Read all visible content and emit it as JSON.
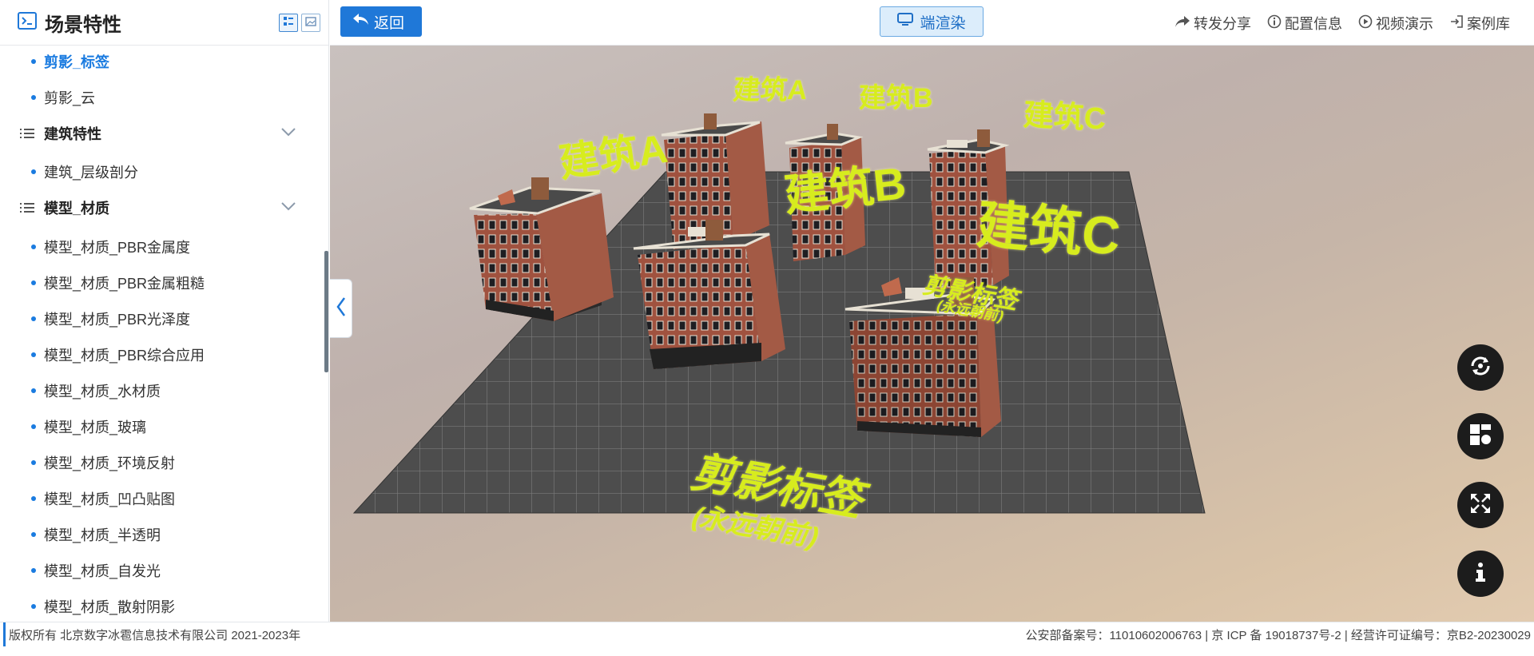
{
  "sidebar": {
    "title": "场景特性",
    "items": [
      {
        "type": "item",
        "label": "剪影_标签",
        "active": true
      },
      {
        "type": "item",
        "label": "剪影_云"
      },
      {
        "type": "group",
        "label": "建筑特性"
      },
      {
        "type": "item",
        "label": "建筑_层级剖分"
      },
      {
        "type": "group",
        "label": "模型_材质"
      },
      {
        "type": "item",
        "label": "模型_材质_PBR金属度"
      },
      {
        "type": "item",
        "label": "模型_材质_PBR金属粗糙"
      },
      {
        "type": "item",
        "label": "模型_材质_PBR光泽度"
      },
      {
        "type": "item",
        "label": "模型_材质_PBR综合应用"
      },
      {
        "type": "item",
        "label": "模型_材质_水材质"
      },
      {
        "type": "item",
        "label": "模型_材质_玻璃"
      },
      {
        "type": "item",
        "label": "模型_材质_环境反射"
      },
      {
        "type": "item",
        "label": "模型_材质_凹凸贴图"
      },
      {
        "type": "item",
        "label": "模型_材质_半透明"
      },
      {
        "type": "item",
        "label": "模型_材质_自发光"
      },
      {
        "type": "item",
        "label": "模型_材质_散射阴影"
      }
    ]
  },
  "toolbar": {
    "back_label": "返回",
    "render_label": "端渲染",
    "links": [
      "转发分享",
      "配置信息",
      "视频演示",
      "案例库"
    ]
  },
  "scene": {
    "labels": {
      "a_small": "建筑A",
      "b_small": "建筑B",
      "c_small": "建筑C",
      "a_large": "建筑A",
      "b_large": "建筑B",
      "c_large": "建筑C",
      "silhouette_far": "剪影标签",
      "silhouette_far_sub": "(永远朝前)",
      "silhouette_near": "剪影标签",
      "silhouette_near_sub": "(永远朝前)"
    }
  },
  "footer": {
    "copyright": "版权所有 北京数字冰雹信息技术有限公司 2021-2023年",
    "registration": "公安部备案号：11010602006763 | 京 ICP 备 19018737号-2 | 经营许可证编号：京B2-20230029"
  },
  "colors": {
    "accent": "#1f78d8",
    "label": "#d7ec1e",
    "brick": "#a0523f"
  }
}
